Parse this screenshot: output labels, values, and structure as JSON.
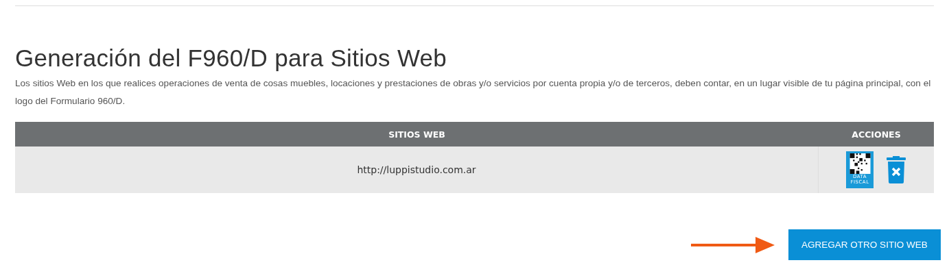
{
  "title": "Generación del F960/D para Sitios Web",
  "description": "Los sitios Web en los que realices operaciones de venta de cosas muebles, locaciones y prestaciones de obras y/o servicios por cuenta propia y/o de terceros, deben contar, en un lugar visible de tu página principal, con el logo del Formulario 960/D.",
  "table": {
    "columns": [
      "SITIOS WEB",
      "ACCIONES"
    ],
    "rows": [
      {
        "site": "http://luppistudio.com.ar",
        "logo_text": [
          "DATA",
          "FISCAL"
        ]
      }
    ]
  },
  "add_button": "AGREGAR OTRO SITIO WEB"
}
